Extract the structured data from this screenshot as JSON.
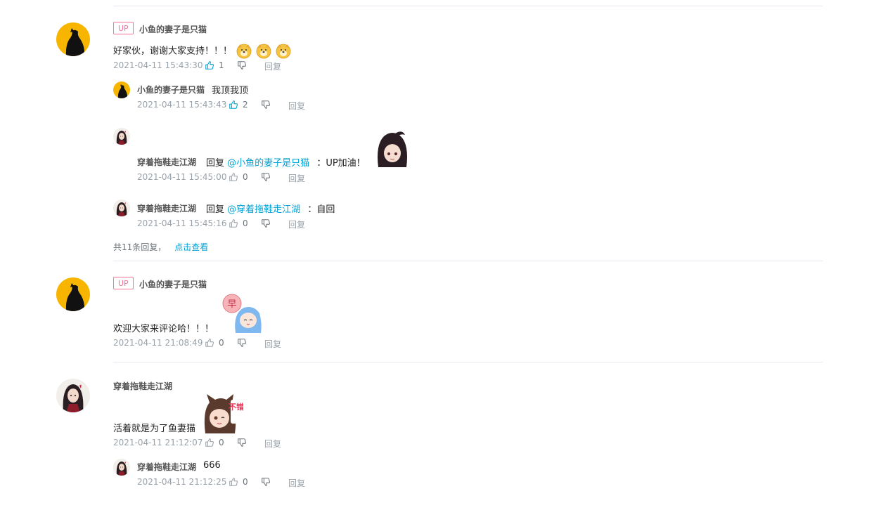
{
  "comments": [
    {
      "badge": "UP",
      "user": "小鱼的妻子是只猫",
      "text": "好家伙，谢谢大家支持！！！",
      "time": "2021-04-11 15:43:30",
      "likes": "1",
      "reply_label": "回复",
      "replies": [
        {
          "user": "小鱼的妻子是只猫",
          "text": "我顶我顶",
          "time": "2021-04-11 15:43:43",
          "likes": "2",
          "reply_label": "回复"
        },
        {
          "user": "穿着拖鞋走江湖",
          "reply_word": "回复",
          "mention": "@小鱼的妻子是只猫",
          "text": "：UP加油！",
          "time": "2021-04-11 15:45:00",
          "likes": "0",
          "reply_label": "回复"
        },
        {
          "user": "穿着拖鞋走江湖",
          "reply_word": "回复",
          "mention": "@穿着拖鞋走江湖",
          "text": "：自回",
          "time": "2021-04-11 15:45:16",
          "likes": "0",
          "reply_label": "回复"
        }
      ],
      "more_text": "共11条回复，",
      "more_link": "点击查看"
    },
    {
      "badge": "UP",
      "user": "小鱼的妻子是只猫",
      "text": "欢迎大家来评论哈！！！",
      "time": "2021-04-11 21:08:49",
      "likes": "0",
      "reply_label": "回复"
    },
    {
      "user": "穿着拖鞋走江湖",
      "text": "活着就是为了鱼妻猫",
      "time": "2021-04-11 21:12:07",
      "likes": "0",
      "reply_label": "回复",
      "replies": [
        {
          "user": "穿着拖鞋走江湖",
          "text": "666",
          "time": "2021-04-11 21:12:25",
          "likes": "0",
          "reply_label": "回复"
        }
      ]
    }
  ],
  "sticker_texts": {
    "hao": "早",
    "bucuo": "不错"
  },
  "colors": {
    "accent": "#00a1d6",
    "up_badge": "#fb7299",
    "meta": "#99a2aa",
    "divider": "#e5e9ef"
  }
}
